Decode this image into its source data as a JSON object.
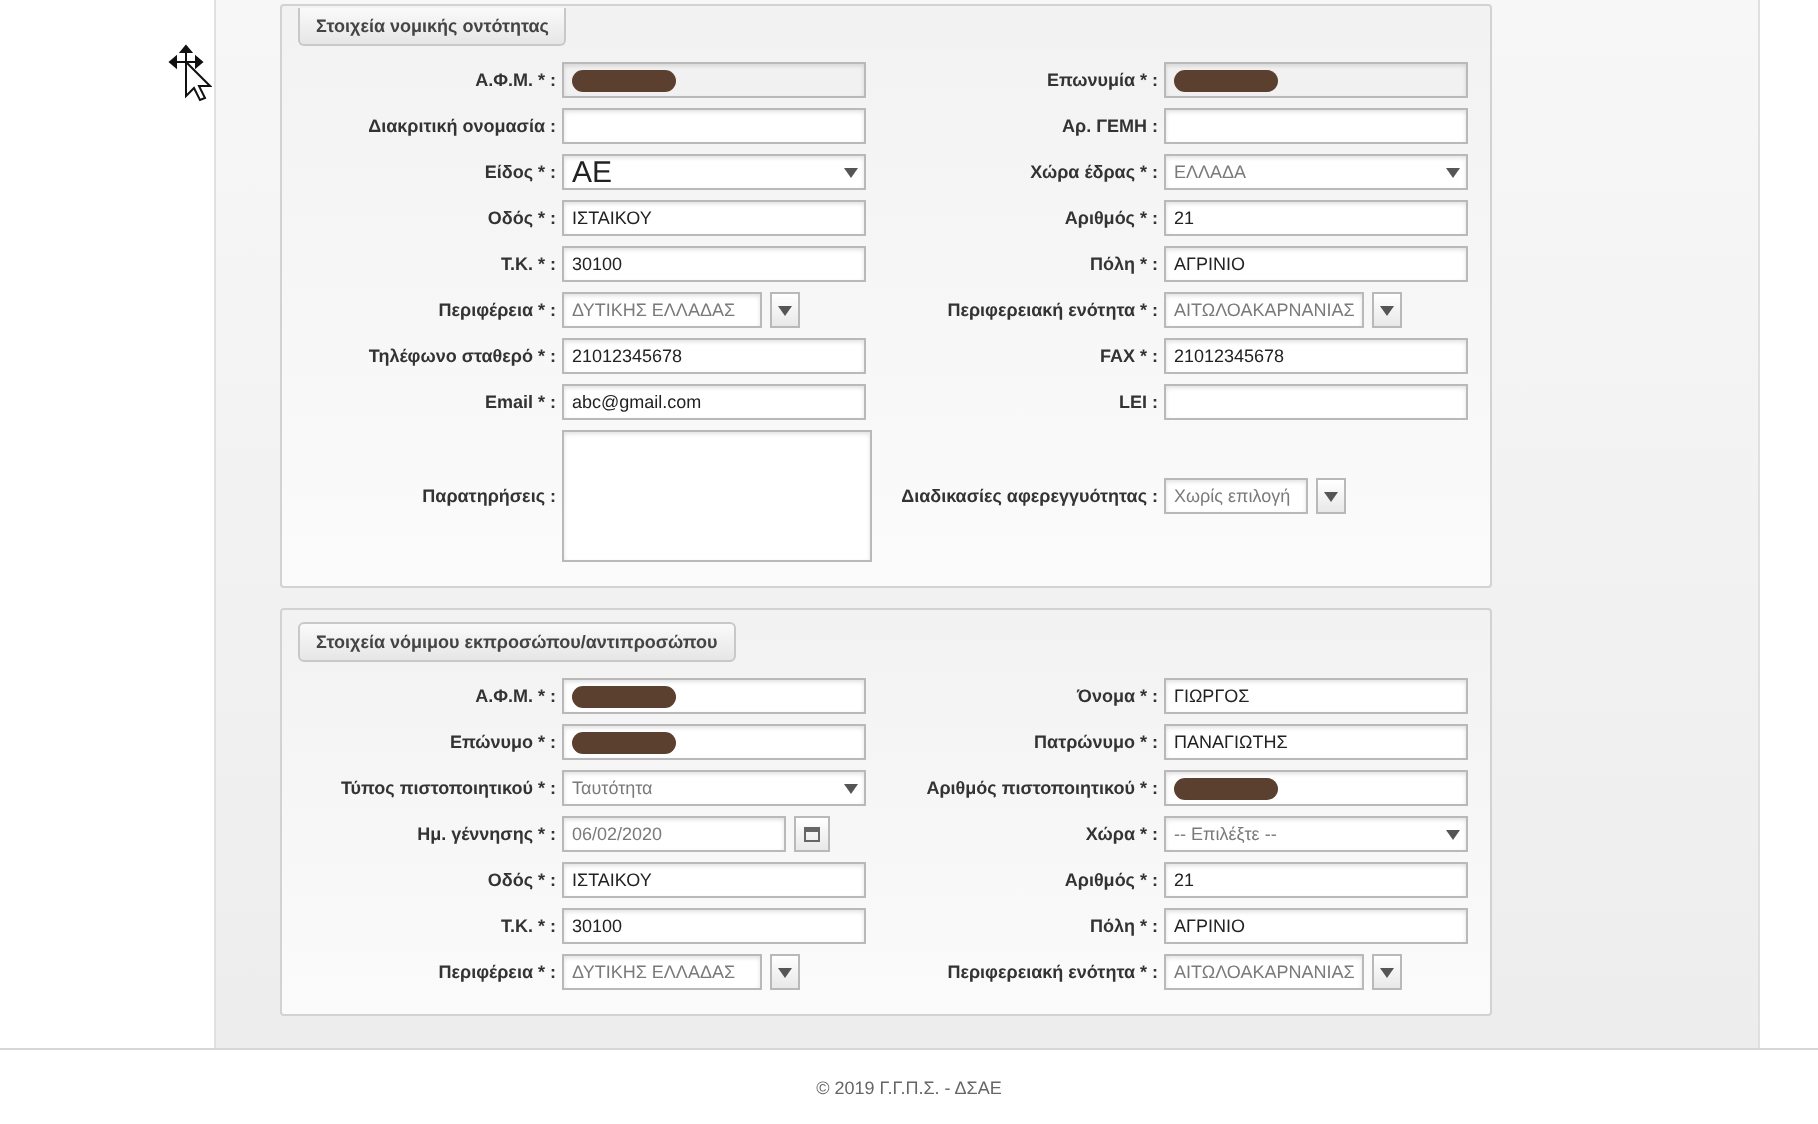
{
  "sections": [
    {
      "legend": "Στοιχεία νομικής οντότητας",
      "rows": [
        {
          "left": {
            "label": "Α.Φ.Μ. * :",
            "kind": "text",
            "disabled": true,
            "redacted": true
          },
          "right": {
            "label": "Επωνυμία * :",
            "kind": "text",
            "disabled": true,
            "redacted": true
          }
        },
        {
          "left": {
            "label": "Διακριτική ονομασία :",
            "kind": "text",
            "disabled": false
          },
          "right": {
            "label": "Αρ. ΓΕΜΗ :",
            "kind": "text",
            "disabled": false
          }
        },
        {
          "left": {
            "label": "Είδος * :",
            "kind": "select",
            "value": "ΑΕ",
            "disabled": false,
            "large": true
          },
          "right": {
            "label": "Χώρα έδρας * :",
            "kind": "select",
            "value": "ΕΛΛΑΔΑ",
            "disabled": true
          }
        },
        {
          "left": {
            "label": "Οδός * :",
            "kind": "text",
            "value": "ΙΣΤΑΙΚΟΥ",
            "disabled": false
          },
          "right": {
            "label": "Αριθμός * :",
            "kind": "text",
            "value": "21",
            "disabled": false
          }
        },
        {
          "left": {
            "label": "Τ.Κ. * :",
            "kind": "text",
            "value": "30100",
            "disabled": false
          },
          "right": {
            "label": "Πόλη * :",
            "kind": "text",
            "value": "ΑΓΡΙΝΙΟ",
            "disabled": false
          }
        },
        {
          "left": {
            "label": "Περιφέρεια * :",
            "kind": "combo",
            "value": "ΔΥΤΙΚΗΣ ΕΛΛΑΔΑΣ",
            "disabled": true
          },
          "right": {
            "label": "Περιφερειακή ενότητα * :",
            "kind": "combo",
            "value": "ΑΙΤΩΛΟΑΚΑΡΝΑΝΙΑΣ",
            "disabled": true
          }
        },
        {
          "left": {
            "label": "Τηλέφωνο σταθερό * :",
            "kind": "text",
            "value": "21012345678",
            "disabled": false
          },
          "right": {
            "label": "FAX * :",
            "kind": "text",
            "value": "21012345678",
            "disabled": false
          }
        },
        {
          "left": {
            "label": "Email * :",
            "kind": "text",
            "value": "abc@gmail.com",
            "disabled": false
          },
          "right": {
            "label": "LEI :",
            "kind": "text",
            "disabled": false
          }
        },
        {
          "left": {
            "label": "Παρατηρήσεις :",
            "kind": "textarea"
          },
          "right": {
            "label": "Διαδικασίες αφερεγγυότητας :",
            "kind": "small-combo",
            "value": "Χωρίς επιλογή",
            "disabled": true
          }
        }
      ]
    },
    {
      "legend": "Στοιχεία νόμιμου εκπροσώπου/αντιπροσώπου",
      "rows": [
        {
          "left": {
            "label": "Α.Φ.Μ. * :",
            "kind": "text",
            "disabled": false,
            "redacted": true
          },
          "right": {
            "label": "Όνομα * :",
            "kind": "text",
            "value": "ΓΙΩΡΓΟΣ",
            "disabled": false
          }
        },
        {
          "left": {
            "label": "Επώνυμο * :",
            "kind": "text",
            "disabled": false,
            "redacted": true
          },
          "right": {
            "label": "Πατρώνυμο * :",
            "kind": "text",
            "value": "ΠΑΝΑΓΙΩΤΗΣ",
            "disabled": false
          }
        },
        {
          "left": {
            "label": "Τύπος πιστοποιητικού * :",
            "kind": "select",
            "value": "Ταυτότητα",
            "disabled": true
          },
          "right": {
            "label": "Αριθμός πιστοποιητικού * :",
            "kind": "text",
            "disabled": false,
            "redacted": true
          }
        },
        {
          "left": {
            "label": "Ημ. γέννησης * :",
            "kind": "date",
            "value": "06/02/2020",
            "disabled": true
          },
          "right": {
            "label": "Χώρα * :",
            "kind": "select",
            "value": "-- Επιλέξτε --",
            "disabled": true
          }
        },
        {
          "left": {
            "label": "Οδός * :",
            "kind": "text",
            "value": "ΙΣΤΑΙΚΟΥ",
            "disabled": false
          },
          "right": {
            "label": "Αριθμός * :",
            "kind": "text",
            "value": "21",
            "disabled": false
          }
        },
        {
          "left": {
            "label": "Τ.Κ. * :",
            "kind": "text",
            "value": "30100",
            "disabled": false
          },
          "right": {
            "label": "Πόλη * :",
            "kind": "text",
            "value": "ΑΓΡΙΝΙΟ",
            "disabled": false
          }
        },
        {
          "left": {
            "label": "Περιφέρεια * :",
            "kind": "combo",
            "value": "ΔΥΤΙΚΗΣ ΕΛΛΑΔΑΣ",
            "disabled": true
          },
          "right": {
            "label": "Περιφερειακή ενότητα * :",
            "kind": "combo",
            "value": "ΑΙΤΩΛΟΑΚΑΡΝΑΝΙΑΣ",
            "disabled": true
          }
        }
      ]
    }
  ],
  "footer": {
    "text": "© 2019 Γ.Γ.Π.Σ. - ΔΣΑΕ"
  }
}
